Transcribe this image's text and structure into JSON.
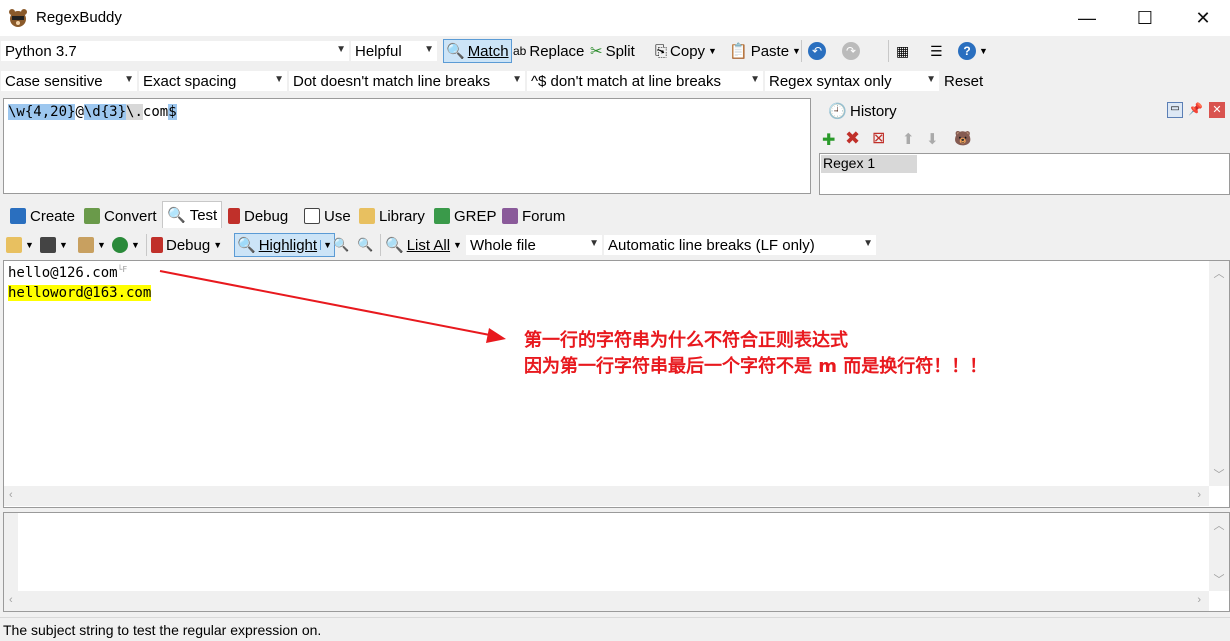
{
  "window": {
    "title": "RegexBuddy",
    "minimize": "—",
    "maximize": "☐",
    "close": "✕"
  },
  "toolbar1": {
    "flavor": "Python 3.7",
    "helpful": "Helpful",
    "match": "Match",
    "replace": "Replace",
    "split": "Split",
    "copy": "Copy",
    "paste": "Paste"
  },
  "toolbar2": {
    "case": "Case sensitive",
    "spacing": "Exact spacing",
    "dot": "Dot doesn't match line breaks",
    "anchors": "^$ don't match at line breaks",
    "syntax": "Regex syntax only",
    "reset": "Reset"
  },
  "regex": {
    "p1": "\\w{4,20}",
    "p2": "@",
    "p3": "\\d{3}",
    "p4": "\\.",
    "p5": "com",
    "p6": "$"
  },
  "history": {
    "title": "History",
    "items": [
      "Regex 1"
    ]
  },
  "tabs": [
    "Create",
    "Convert",
    "Test",
    "Debug",
    "Use",
    "Library",
    "GREP",
    "Forum"
  ],
  "test_toolbar": {
    "debug": "Debug",
    "highlight": "Highlight",
    "list_all": "List All",
    "scope": "Whole file",
    "linebreaks": "Automatic line breaks (LF only)"
  },
  "subject_lines": [
    "hello@126.com",
    "helloword@163.com"
  ],
  "annotation": {
    "line1": "第一行的字符串为什么不符合正则表达式",
    "line2": "因为第一行字符串最后一个字符不是 m  而是换行符！！！",
    "color": "#e8191e"
  },
  "status": "The subject string to test the regular expression on."
}
